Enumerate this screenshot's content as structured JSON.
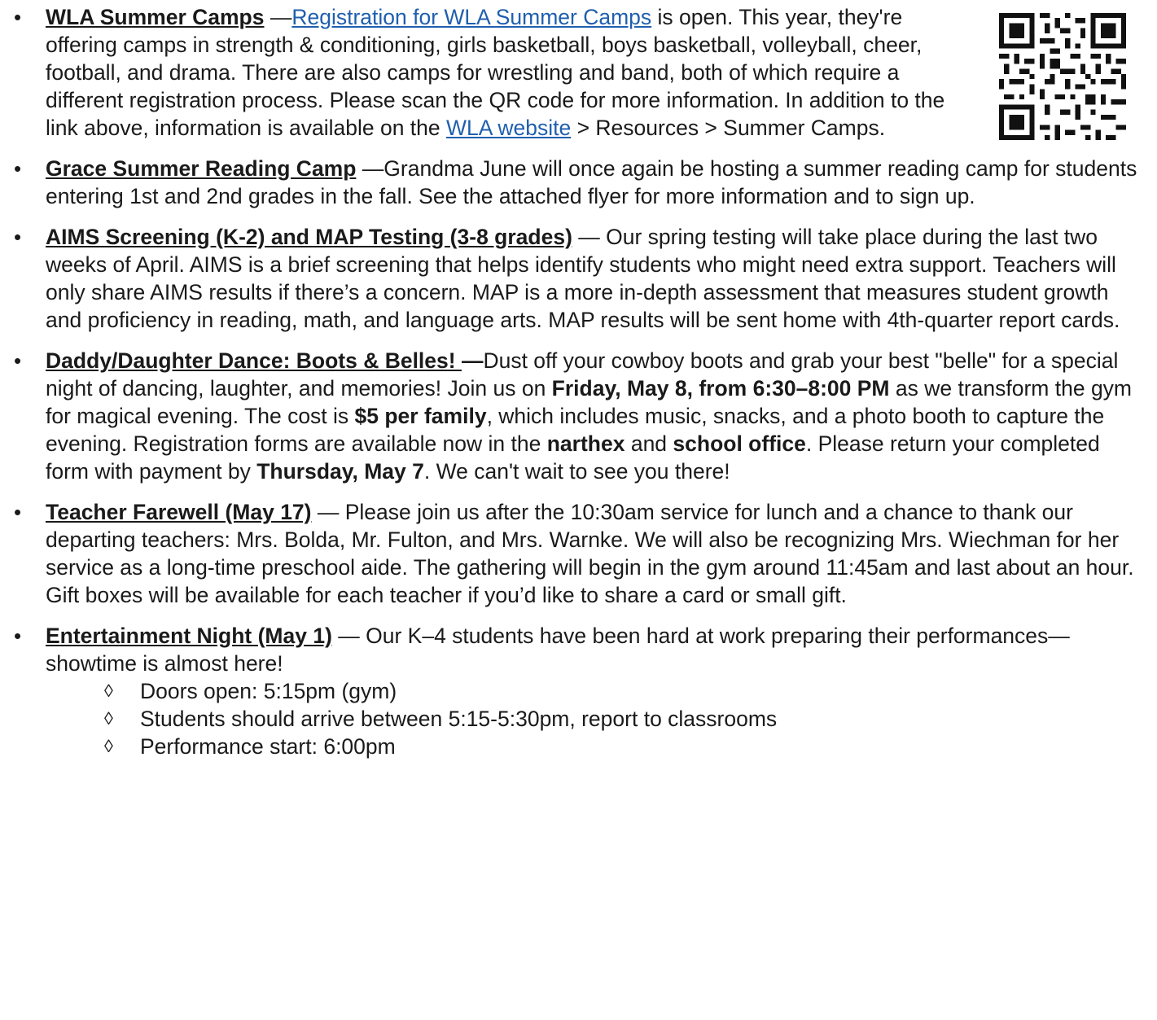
{
  "items": [
    {
      "heading": "WLA Summer Camps",
      "dash": " —",
      "link1": "Registration for WLA Summer Camps",
      "text1": " is open. This year, they're offering camps in strength & conditioning, girls basketball, boys basketball, volleyball, cheer, football, and drama. There are also camps for wrestling and band, both of which require a different registration process. Please scan the QR code for more information. In addition to the link above, information is available on the ",
      "link2": "WLA website",
      "text2": " > Resources > Summer Camps."
    },
    {
      "heading": "Grace Summer Reading Camp",
      "text": " —Grandma June will once again be hosting a summer reading camp for students entering 1st and 2nd grades in the fall. See the attached flyer for more information and to sign up."
    },
    {
      "heading": "AIMS Screening (K-2) and MAP Testing (3-8 grades)",
      "text": " — Our spring testing will take place during the last two weeks of April. AIMS is a brief screening that helps identify students who might need extra support. Teachers will only share AIMS results if there’s a concern. MAP is a more in-depth assessment that measures student growth and proficiency in reading, math, and language arts. MAP results will be sent home with 4th-quarter report cards."
    },
    {
      "heading": "Daddy/Daughter Dance: Boots & Belles! ",
      "dash": "—",
      "t1": "Dust off your cowboy boots and grab your best \"belle\" for a special night of dancing, laughter, and memories! Join us on ",
      "b1": "Friday, May 8, from 6:30–8:00 PM",
      "t2": " as we transform the gym for magical evening. The cost is ",
      "b2": "$5 per family",
      "t3": ", which includes music, snacks, and a photo booth to capture the evening. Registration forms are available now in the ",
      "b3": "narthex",
      "t4": " and ",
      "b4": "school office",
      "t5": ". Please return your completed form with payment by ",
      "b5": "Thursday, May 7",
      "t6": ". We can't wait to see you there!"
    },
    {
      "heading": "Teacher Farewell (May 17)",
      "text": " — Please join us after the 10:30am service for lunch and a chance to thank our departing teachers: Mrs. Bolda, Mr. Fulton, and Mrs. Warnke. We will also be recognizing Mrs. Wiechman for her service as a long-time preschool aide.  The gathering will begin in the gym around 11:45am and last about an hour. Gift boxes will be available for each teacher if you’d like to share a card or small gift."
    },
    {
      "heading": "Entertainment Night (May 1)",
      "text": " — Our K–4 students have been hard at work preparing their performances—showtime is almost here!",
      "subitems": [
        "Doors open: 5:15pm (gym)",
        "Students should arrive between 5:15-5:30pm, report to classrooms",
        "Performance start: 6:00pm"
      ]
    }
  ],
  "bullet_glyph": "•",
  "subbullet_glyph": "◊",
  "colors": {
    "link": "#1f5fae",
    "text": "#1a1a1a"
  }
}
